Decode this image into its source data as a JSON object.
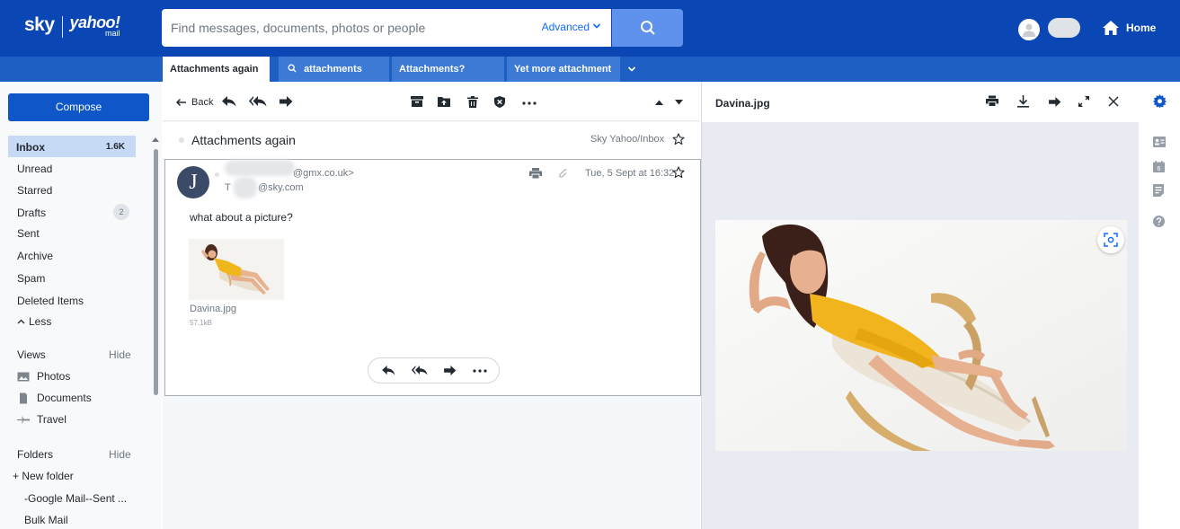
{
  "header": {
    "logo_sky": "sky",
    "logo_yahoo": "yahoo!",
    "logo_mail": "mail",
    "search_placeholder": "Find messages, documents, photos or people",
    "advanced_label": "Advanced",
    "home_label": "Home",
    "brand_color": "#0a47b4"
  },
  "tabs": [
    {
      "label": "Attachments again",
      "active": true
    },
    {
      "label": "attachments",
      "icon": "search-icon",
      "active": false
    },
    {
      "label": "Attachments?",
      "active": false
    },
    {
      "label": "Yet more attachment",
      "active": false
    }
  ],
  "sidebar": {
    "compose_label": "Compose",
    "inbox": {
      "label": "Inbox",
      "count": "1.6K"
    },
    "items": [
      {
        "label": "Unread"
      },
      {
        "label": "Starred"
      },
      {
        "label": "Drafts",
        "badge": "2"
      },
      {
        "label": "Sent"
      },
      {
        "label": "Archive"
      },
      {
        "label": "Spam"
      },
      {
        "label": "Deleted Items"
      },
      {
        "label": "Less"
      }
    ],
    "views_heading": "Views",
    "views_hide": "Hide",
    "views": [
      {
        "label": "Photos",
        "icon": "photos-icon"
      },
      {
        "label": "Documents",
        "icon": "documents-icon"
      },
      {
        "label": "Travel",
        "icon": "travel-icon"
      }
    ],
    "folders_heading": "Folders",
    "folders_hide": "Hide",
    "new_folder_label": "+ New folder",
    "folders": [
      {
        "label": "-Google Mail--Sent ..."
      },
      {
        "label": "Bulk Mail"
      }
    ]
  },
  "message": {
    "back_label": "Back",
    "subject": "Attachments again",
    "folder": "Sky Yahoo/Inbox",
    "sender_initial": "J",
    "from_suffix": "@gmx.co.uk>",
    "to_prefix": "T",
    "to_suffix": "@sky.com",
    "date": "Tue, 5 Sept at 16:32",
    "body": "what about a picture?",
    "attachment": {
      "name": "Davina.jpg",
      "size": "57.1kB"
    }
  },
  "viewer": {
    "title": "Davina.jpg"
  }
}
